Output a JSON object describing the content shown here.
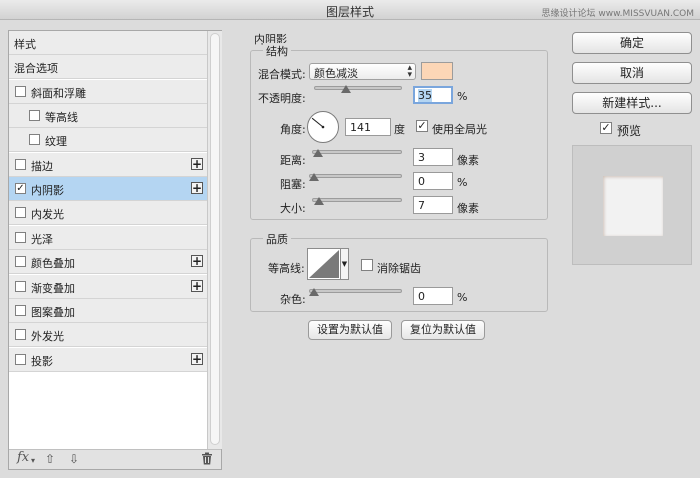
{
  "window": {
    "title": "图层样式",
    "watermark": "思缘设计论坛 www.MISSVUAN.COM"
  },
  "styles_list": {
    "items": [
      {
        "label": "样式",
        "checkbox": false,
        "checked": false,
        "plus": false,
        "indent": 0,
        "selected": false
      },
      {
        "label": "混合选项",
        "checkbox": false,
        "checked": false,
        "plus": false,
        "indent": 0,
        "selected": false
      },
      {
        "label": "斜面和浮雕",
        "checkbox": true,
        "checked": false,
        "plus": false,
        "indent": 0,
        "selected": false
      },
      {
        "label": "等高线",
        "checkbox": true,
        "checked": false,
        "plus": false,
        "indent": 1,
        "selected": false
      },
      {
        "label": "纹理",
        "checkbox": true,
        "checked": false,
        "plus": false,
        "indent": 1,
        "selected": false
      },
      {
        "label": "描边",
        "checkbox": true,
        "checked": false,
        "plus": true,
        "indent": 0,
        "selected": false
      },
      {
        "label": "内阴影",
        "checkbox": true,
        "checked": true,
        "plus": true,
        "indent": 0,
        "selected": true
      },
      {
        "label": "内发光",
        "checkbox": true,
        "checked": false,
        "plus": false,
        "indent": 0,
        "selected": false
      },
      {
        "label": "光泽",
        "checkbox": true,
        "checked": false,
        "plus": false,
        "indent": 0,
        "selected": false
      },
      {
        "label": "颜色叠加",
        "checkbox": true,
        "checked": false,
        "plus": true,
        "indent": 0,
        "selected": false
      },
      {
        "label": "渐变叠加",
        "checkbox": true,
        "checked": false,
        "plus": true,
        "indent": 0,
        "selected": false
      },
      {
        "label": "图案叠加",
        "checkbox": true,
        "checked": false,
        "plus": false,
        "indent": 0,
        "selected": false
      },
      {
        "label": "外发光",
        "checkbox": true,
        "checked": false,
        "plus": false,
        "indent": 0,
        "selected": false
      },
      {
        "label": "投影",
        "checkbox": true,
        "checked": false,
        "plus": true,
        "indent": 0,
        "selected": false
      }
    ],
    "footer": {
      "fx_label": "fx",
      "fx_icon": "fx-icon",
      "up_icon": "arrow-up-icon",
      "down_icon": "arrow-down-icon",
      "trash_icon": "trash-icon"
    }
  },
  "inner_shadow": {
    "section_title": "内阴影",
    "structure": {
      "title": "结构",
      "blend_mode_label": "混合模式:",
      "blend_mode_value": "颜色减淡",
      "shadow_color": "#fcd6b6",
      "opacity_label": "不透明度:",
      "opacity_value": "35",
      "opacity_fraction": 0.35,
      "opacity_unit": "%",
      "angle_label": "角度:",
      "angle_value": "141",
      "angle_degrees": 141,
      "angle_unit": "度",
      "global_light_label": "使用全局光",
      "global_light_checked": true,
      "distance_label": "距离:",
      "distance_value": "3",
      "distance_unit": "像素",
      "distance_fraction": 0.012,
      "choke_label": "阻塞:",
      "choke_value": "0",
      "choke_unit": "%",
      "choke_fraction": 0.0,
      "size_label": "大小:",
      "size_value": "7",
      "size_unit": "像素",
      "size_fraction": 0.03
    },
    "quality": {
      "title": "品质",
      "contour_label": "等高线:",
      "anti_alias_label": "消除锯齿",
      "anti_alias_checked": false,
      "noise_label": "杂色:",
      "noise_value": "0",
      "noise_unit": "%",
      "noise_fraction": 0.0
    },
    "make_default_label": "设置为默认值",
    "reset_default_label": "复位为默认值"
  },
  "actions": {
    "ok_label": "确定",
    "cancel_label": "取消",
    "new_style_label": "新建样式...",
    "preview_label": "预览",
    "preview_checked": true
  },
  "colors": {
    "selected_row": "#b4d5f2",
    "panel_bg": "#dcdcdc"
  }
}
